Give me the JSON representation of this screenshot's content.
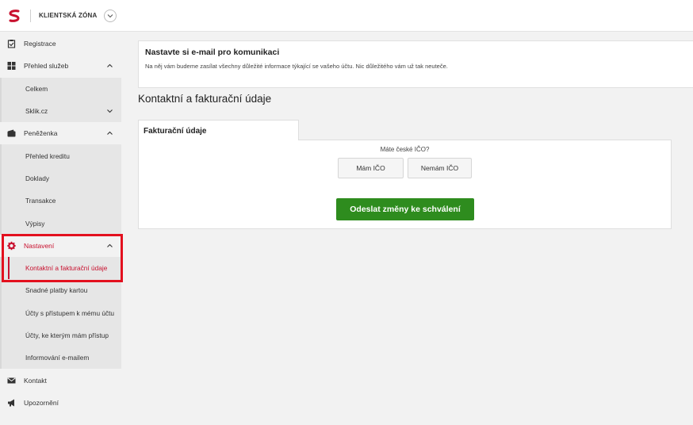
{
  "header": {
    "zone_label": "KLIENTSKÁ ZÓNA",
    "brand_color": "#c8102e"
  },
  "sidebar": {
    "items": [
      {
        "label": "Registrace",
        "icon": "clipboard-check-icon"
      },
      {
        "label": "Přehled služeb",
        "icon": "grid-icon",
        "expanded": true
      },
      {
        "label": "Celkem"
      },
      {
        "label": "Sklik.cz",
        "collapsed": true
      },
      {
        "label": "Peněženka",
        "icon": "wallet-icon",
        "expanded": true
      },
      {
        "label": "Přehled kreditu"
      },
      {
        "label": "Doklady"
      },
      {
        "label": "Transakce"
      },
      {
        "label": "Výpisy"
      },
      {
        "label": "Nastavení",
        "icon": "gear-icon",
        "expanded": true,
        "active": true
      },
      {
        "label": "Kontaktní a fakturační údaje",
        "active": true
      },
      {
        "label": "Snadné platby kartou"
      },
      {
        "label": "Účty s přístupem k mému účtu"
      },
      {
        "label": "Účty, ke kterým mám přístup"
      },
      {
        "label": "Informování e-mailem"
      },
      {
        "label": "Kontakt",
        "icon": "envelope-icon"
      },
      {
        "label": "Upozornění",
        "icon": "megaphone-icon"
      }
    ]
  },
  "email_notice": {
    "title": "Nastavte si e-mail pro komunikaci",
    "text": "Na něj vám budeme zasílat všechny důležité informace týkající se vašeho účtu. Nic důležitého vám už tak neuteče."
  },
  "main": {
    "section_title": "Kontaktní a fakturační údaje",
    "tab_label": "Fakturační údaje",
    "ico_question": "Máte české IČO?",
    "btn_have_ico": "Mám IČO",
    "btn_no_ico": "Nemám IČO",
    "submit_label": "Odeslat změny ke schválení",
    "submit_color": "#2e8c1e"
  }
}
